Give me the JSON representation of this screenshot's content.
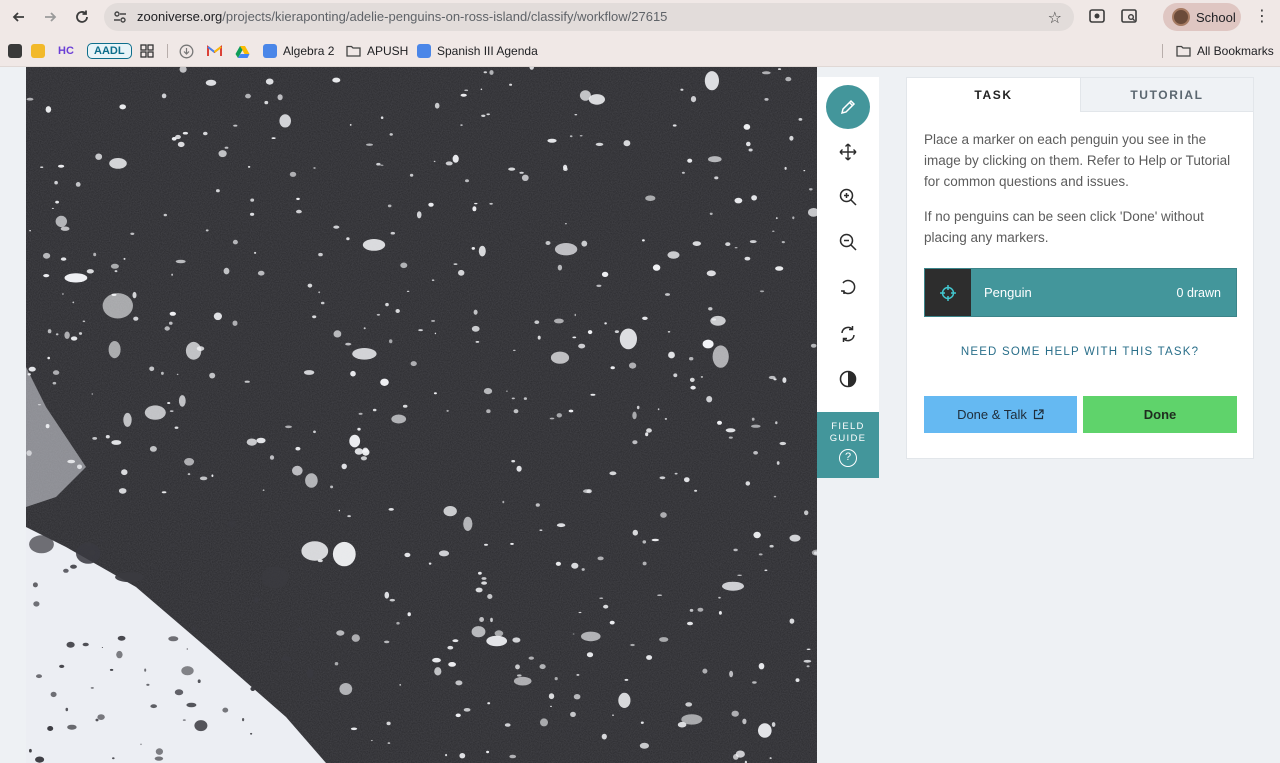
{
  "browser": {
    "url_domain": "zooniverse.org",
    "url_path": "/projects/kieraponting/adelie-penguins-on-ross-island/classify/workflow/27615",
    "profile_name": "School"
  },
  "bookmarks": {
    "hc": "HC",
    "aadl": "AADL",
    "items": [
      "Algebra 2",
      "APUSH",
      "Spanish III Agenda"
    ],
    "all_bookmarks": "All Bookmarks"
  },
  "toolbar": {
    "tools": [
      "pencil-icon",
      "move-icon",
      "zoom-in-icon",
      "zoom-out-icon",
      "rotate-icon",
      "reset-icon",
      "contrast-icon"
    ],
    "field_guide": "FIELD\nGUIDE",
    "field_guide_icon": "?"
  },
  "panel": {
    "tab_task": "TASK",
    "tab_tutorial": "TUTORIAL",
    "instruction_1": "Place a marker on each penguin you see in the image by clicking on them. Refer to Help or Tutorial for common questions and issues.",
    "instruction_2": "If no penguins can be seen click 'Done' without placing any markers.",
    "tool_label": "Penguin",
    "tool_count": "0 drawn",
    "help_link": "NEED SOME HELP WITH THIS TASK?",
    "done_talk": "Done & Talk",
    "done": "Done"
  },
  "colors": {
    "accent": "#43969b",
    "done_talk": "#65b9f2",
    "done": "#5fd36b"
  }
}
